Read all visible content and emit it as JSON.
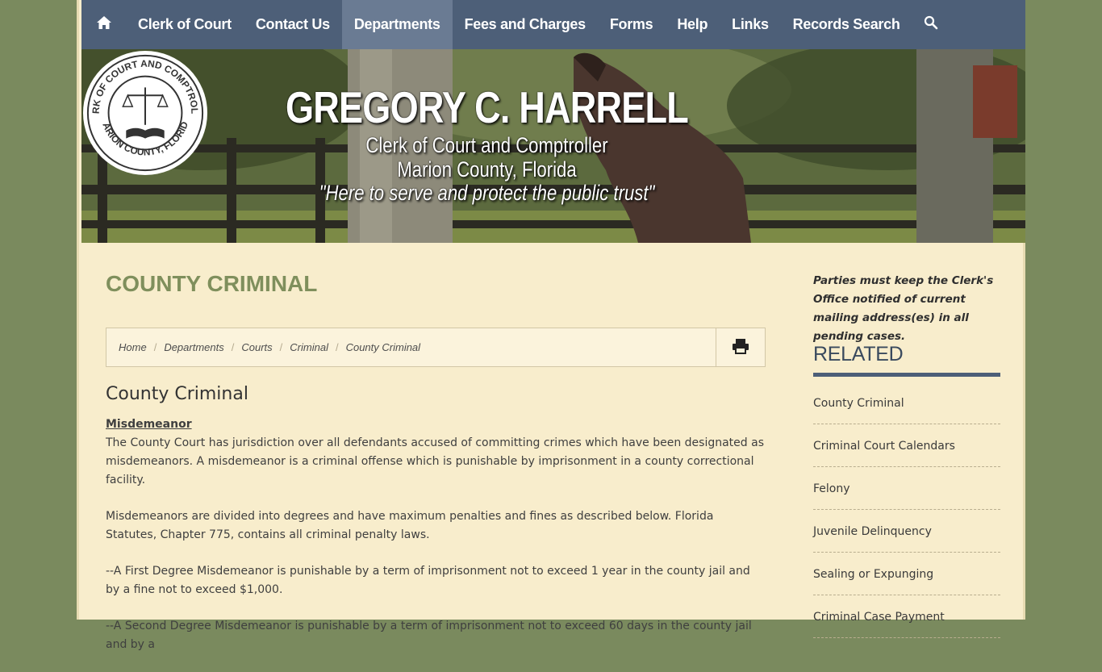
{
  "nav": {
    "home_icon": "home-icon",
    "items": [
      {
        "label": "Clerk of Court"
      },
      {
        "label": "Contact Us"
      },
      {
        "label": "Departments"
      },
      {
        "label": "Fees and Charges"
      },
      {
        "label": "Forms"
      },
      {
        "label": "Help"
      },
      {
        "label": "Links"
      },
      {
        "label": "Records Search"
      }
    ],
    "search_icon": "search-icon",
    "active_item": "Departments"
  },
  "banner": {
    "name": "GREGORY C. HARRELL",
    "office": "Clerk of Court and Comptroller",
    "county": "Marion County, Florida",
    "tagline": "\"Here to serve and protect the public trust\"",
    "seal": {
      "top_text": "CLERK OF COURT AND COMPTROLLER",
      "bottom_text": "MARION COUNTY, FLORIDA"
    }
  },
  "main": {
    "title": "COUNTY CRIMINAL",
    "breadcrumb": [
      "Home",
      "Departments",
      "Courts",
      "Criminal",
      "County Criminal"
    ],
    "print_icon": "print-icon",
    "heading": "County Criminal",
    "section_label": "Misdemeanor",
    "paragraphs": [
      "The County Court has jurisdiction over all defendants accused of committing crimes which have been designated as misdemeanors. A misdemeanor is a criminal offense which is punishable by imprisonment in a county correctional facility.",
      "Misdemeanors are divided into degrees and have maximum penalties and fines as described below. Florida Statutes, Chapter 775, contains all criminal penalty laws.",
      "--A First Degree Misdemeanor is punishable by a term of imprisonment not to exceed 1 year in the county jail and by a fine not to exceed $1,000.",
      "--A Second Degree Misdemeanor is punishable by a term of imprisonment not to exceed 60 days in the county jail and by a"
    ]
  },
  "sidebar": {
    "notice": "Parties must keep the Clerk's Office notified of current mailing address(es) in all pending cases.",
    "related_title": "RELATED",
    "related": [
      "County Criminal",
      "Criminal Court Calendars",
      "Felony",
      "Juvenile Delinquency",
      "Sealing or Expunging",
      "Criminal Case Payment"
    ]
  },
  "colors": {
    "background": "#7a8a5e",
    "page": "#f8edcc",
    "nav": "#4d5f78",
    "nav_active": "#6a7b93",
    "title": "#7f8f5c"
  }
}
